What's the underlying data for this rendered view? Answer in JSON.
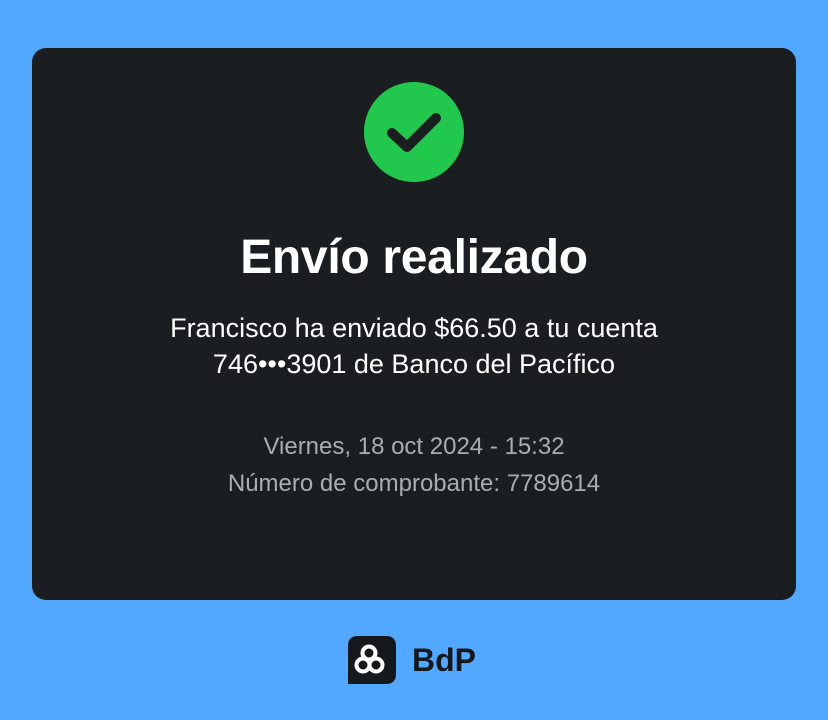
{
  "receipt": {
    "title": "Envío realizado",
    "message_line1": "Francisco ha enviado $66.50 a tu cuenta",
    "message_line2": "746•••3901 de Banco del Pacífico",
    "date_time": "Viernes, 18 oct 2024 - 15:32",
    "voucher": "Número de comprobante: 7789614",
    "status_icon": "check-circle-icon"
  },
  "footer": {
    "brand_text": "BdP",
    "logo_icon": "bdp-logo-icon"
  },
  "colors": {
    "background": "#52a8ff",
    "card": "#1b1e21",
    "success": "#22c84e",
    "secondary_text": "#a9adb1",
    "brand": "#15191d"
  }
}
